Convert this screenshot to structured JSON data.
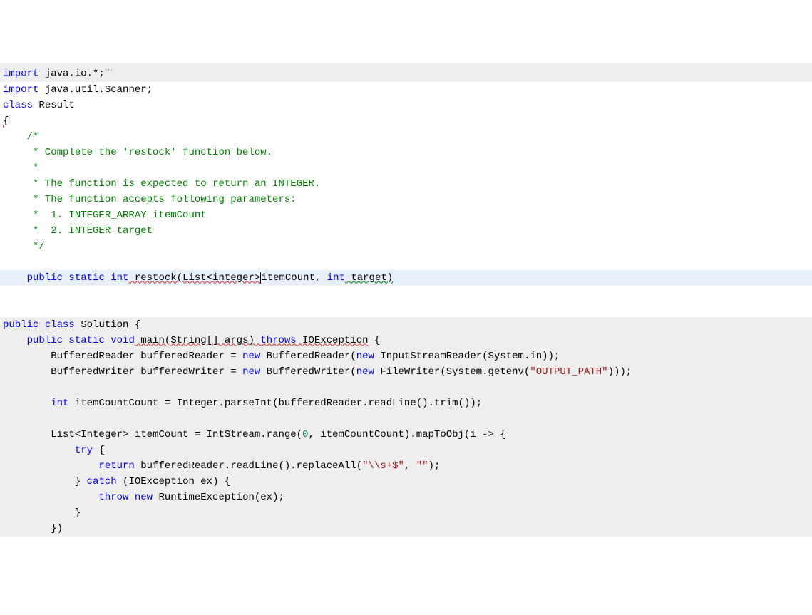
{
  "lines": {
    "l1": {
      "kw": "import",
      "pkg": " java.io.*;",
      "fold": "⋯"
    },
    "l2": {
      "kw": "import",
      "pkg": " java.util.Scanner;"
    },
    "l3": {
      "kw": "class",
      "name": " Result"
    },
    "l4": {
      "brace": "{"
    },
    "l5": {
      "text": "    /*"
    },
    "l6": {
      "text": "     * Complete the 'restock' function below."
    },
    "l7": {
      "text": "     *"
    },
    "l8": {
      "text": "     * The function is expected to return an INTEGER."
    },
    "l9": {
      "text": "     * The function accepts following parameters:"
    },
    "l10": {
      "text": "     *  1. INTEGER_ARRAY itemCount"
    },
    "l11": {
      "text": "     *  2. INTEGER target"
    },
    "l12": {
      "text": "     */"
    },
    "l13": {
      "indent": "    ",
      "pub": "public",
      "stat": " static",
      "ret": " int",
      "fn": " restock(List<integer>",
      "param": "itemCount, ",
      "intk": "int",
      "param2": " target)"
    },
    "l14": {
      "pub": "public",
      "cls": " class",
      "name": " Solution {"
    },
    "l15": {
      "indent": "    ",
      "pub": "public",
      "stat": " static",
      "vd": " void",
      "fn": " main(String[] args) ",
      "thr": "throws",
      "exc": " IOException",
      "brace": " {"
    },
    "l16": {
      "indent": "        ",
      "t1": "BufferedReader bufferedReader = ",
      "new1": "new",
      "t2": " BufferedReader(",
      "new2": "new",
      "t3": " InputStreamReader(System.in));"
    },
    "l17": {
      "indent": "        ",
      "t1": "BufferedWriter bufferedWriter = ",
      "new1": "new",
      "t2": " BufferedWriter(",
      "new2": "new",
      "t3": " FileWriter(System.getenv(",
      "str": "\"OUTPUT_PATH\"",
      "t4": ")));"
    },
    "l18": {
      "indent": "        ",
      "intk": "int",
      "t1": " itemCountCount = Integer.parseInt(bufferedReader.readLine().trim());"
    },
    "l19": {
      "indent": "        ",
      "t1": "List<Integer> itemCount = IntStream.range(",
      "num": "0",
      "t2": ", itemCountCount).mapToObj(i -> {"
    },
    "l20": {
      "indent": "            ",
      "try": "try",
      "brace": " {"
    },
    "l21": {
      "indent": "                ",
      "ret": "return",
      "t1": " bufferedReader.readLine().replaceAll(",
      "str1": "\"\\\\s+$\"",
      "comma": ", ",
      "str2": "\"\"",
      "t2": ");"
    },
    "l22": {
      "indent": "            ",
      "brace1": "} ",
      "catch": "catch",
      "t1": " (IOException ex) {"
    },
    "l23": {
      "indent": "                ",
      "throw": "throw",
      "new1": " new",
      "t1": " RuntimeException(ex);"
    },
    "l24": {
      "indent": "            ",
      "brace": "}"
    },
    "l25": {
      "indent": "        ",
      "brace": "})"
    }
  }
}
